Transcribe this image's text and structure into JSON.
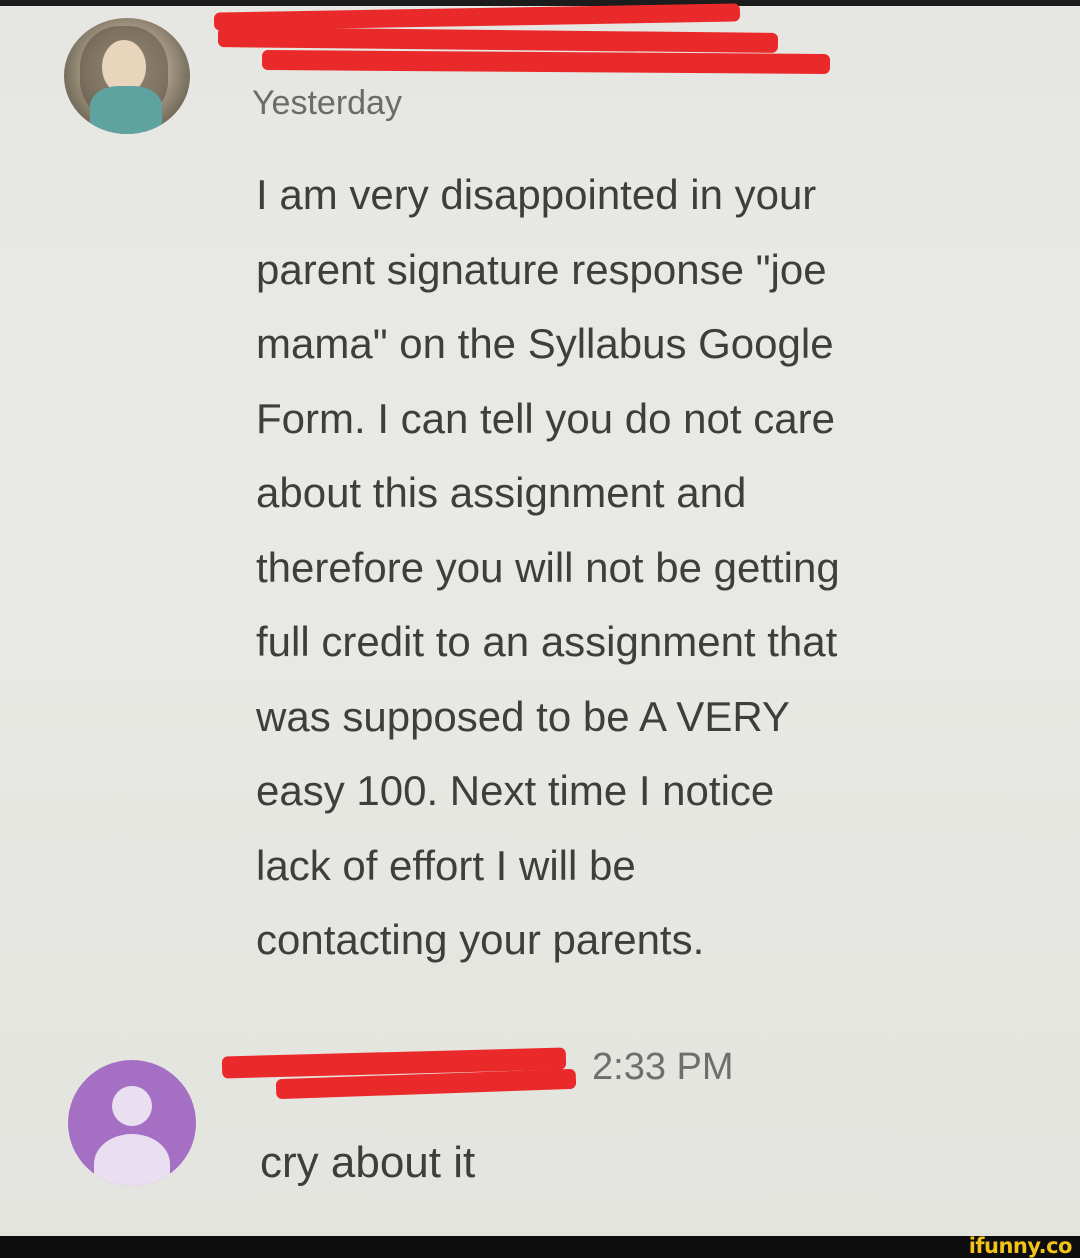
{
  "comments": [
    {
      "timestamp": "Yesterday",
      "text": "I am very disappointed in your\nparent signature response \"joe\nmama\" on the Syllabus Google\nForm. I can tell you do not care\nabout this assignment and\ntherefore you will not be getting\nfull credit to an assignment that\nwas supposed to be A VERY\neasy 100. Next time I notice\nlack of effort I will be\ncontacting your parents."
    },
    {
      "timestamp": "2:33 PM",
      "text": "cry about it"
    }
  ],
  "watermark": "ifunny.co",
  "colors": {
    "background": "#e7e7e3",
    "text": "#3e3e3c",
    "redaction": "#ea2a2a",
    "avatar_purple": "#a570c4",
    "watermark": "#f2c21a"
  },
  "icons": [
    "profile-photo-avatar",
    "default-person-avatar"
  ]
}
